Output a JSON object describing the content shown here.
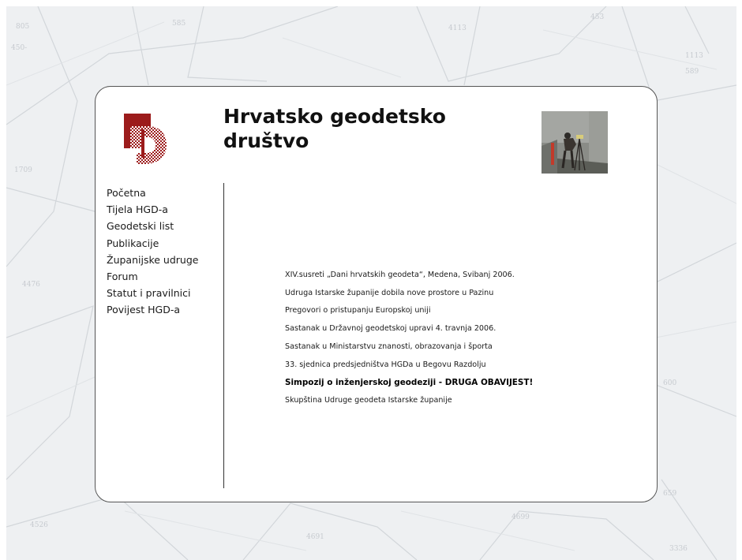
{
  "header": {
    "title_line1": "Hrvatsko geodetsko",
    "title_line2": "društvo"
  },
  "nav": {
    "items": [
      {
        "label": "Početna"
      },
      {
        "label": "Tijela HGD-a"
      },
      {
        "label": "Geodetski list"
      },
      {
        "label": "Publikacije"
      },
      {
        "label": "Županijske udruge"
      },
      {
        "label": "Forum"
      },
      {
        "label": "Statut i pravilnici"
      },
      {
        "label": "Povijest HGD-a"
      }
    ]
  },
  "news": {
    "items": [
      {
        "label": "XIV.susreti „Dani hrvatskih geodeta“, Medena, Svibanj 2006."
      },
      {
        "label": "Udruga Istarske županije dobila nove prostore u Pazinu"
      },
      {
        "label": "Pregovori o pristupanju Europskoj uniji"
      },
      {
        "label": "Sastanak u Državnoj geodetskoj upravi 4. travnja 2006."
      },
      {
        "label": "Sastanak u Ministarstvu znanosti, obrazovanja i športa"
      },
      {
        "label": "33. sjednica predsjedništva HGDa u Begovu Razdolju"
      },
      {
        "label": "Simpozij o inženjerskoj geodeziji - DRUGA OBAVIJEST!"
      },
      {
        "label": "Skupština Udruge geodeta Istarske županije"
      }
    ]
  },
  "colors": {
    "logo_red": "#9c1c1c",
    "background": "#eef0f2",
    "card": "#ffffff"
  }
}
